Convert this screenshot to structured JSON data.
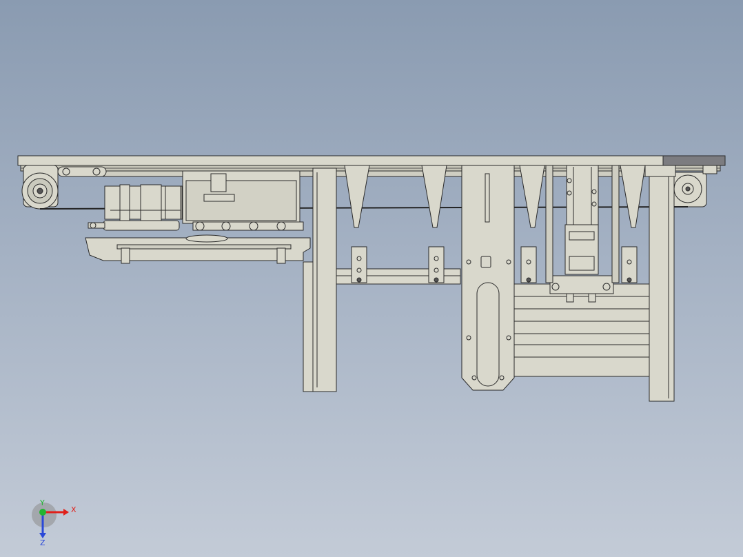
{
  "viewport": {
    "background_top": "#8a9bb1",
    "background_bottom": "#c3cbd7"
  },
  "model": {
    "part_fill": "#d9d8cc",
    "part_fill_dark": "#bdbcb0",
    "edge_color": "#2a2a2a",
    "accent_gray": "#7c7c80"
  },
  "triad": {
    "x_label": "X",
    "y_label": "Y",
    "z_label": "Z",
    "x_color": "#e0201a",
    "y_color": "#22b530",
    "z_color": "#2a48d8"
  }
}
